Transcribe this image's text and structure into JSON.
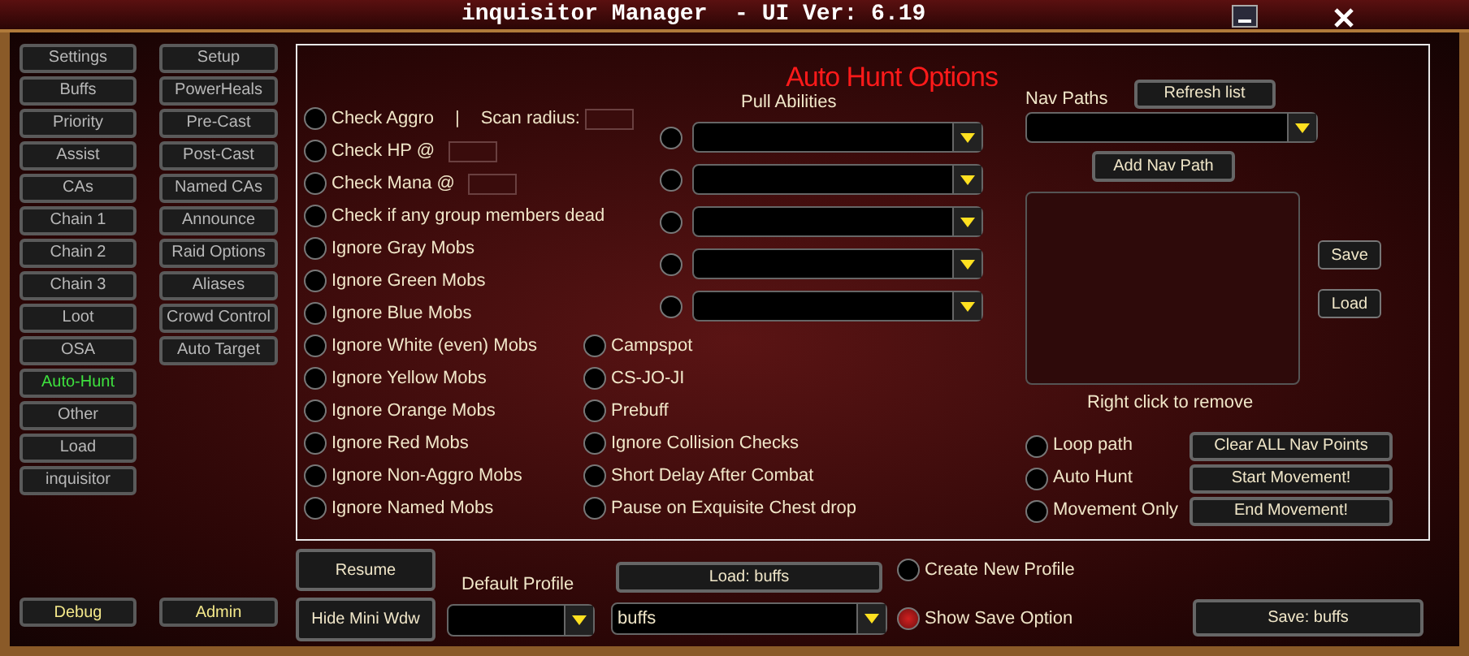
{
  "window": {
    "title": "inquisitor Manager  - UI Ver: 6.19"
  },
  "sidebar": {
    "left": [
      {
        "label": "Settings",
        "selected": false
      },
      {
        "label": "Buffs",
        "selected": false
      },
      {
        "label": "Priority",
        "selected": false
      },
      {
        "label": "Assist",
        "selected": false
      },
      {
        "label": "CAs",
        "selected": false
      },
      {
        "label": "Chain 1",
        "selected": false
      },
      {
        "label": "Chain 2",
        "selected": false
      },
      {
        "label": "Chain 3",
        "selected": false
      },
      {
        "label": "Loot",
        "selected": false
      },
      {
        "label": "OSA",
        "selected": false
      },
      {
        "label": "Auto-Hunt",
        "selected": true
      },
      {
        "label": "Other",
        "selected": false
      },
      {
        "label": "Load",
        "selected": false
      },
      {
        "label": "inquisitor",
        "selected": false
      }
    ],
    "right": [
      {
        "label": "Setup",
        "selected": false
      },
      {
        "label": "PowerHeals",
        "selected": false
      },
      {
        "label": "Pre-Cast",
        "selected": false
      },
      {
        "label": "Post-Cast",
        "selected": false
      },
      {
        "label": "Named CAs",
        "selected": false
      },
      {
        "label": "Announce",
        "selected": false
      },
      {
        "label": "Raid Options",
        "selected": false
      },
      {
        "label": "Aliases",
        "selected": false
      },
      {
        "label": "Crowd Control",
        "selected": false
      },
      {
        "label": "Auto Target",
        "selected": false
      }
    ],
    "footer_buttons": [
      "Debug",
      "Admin"
    ]
  },
  "panel": {
    "title": "Auto Hunt Options",
    "options": [
      {
        "kind": "scan",
        "label": "Check Aggro",
        "divider": "|",
        "field_label": "Scan radius:",
        "checked": false
      },
      {
        "kind": "field",
        "label": "Check HP @",
        "checked": false
      },
      {
        "kind": "field",
        "label": "Check Mana @",
        "checked": false
      },
      {
        "kind": "plain",
        "label": "Check if any group members dead",
        "checked": false
      },
      {
        "kind": "plain",
        "label": "Ignore Gray Mobs",
        "checked": false
      },
      {
        "kind": "plain",
        "label": "Ignore Green Mobs",
        "checked": false
      },
      {
        "kind": "plain",
        "label": "Ignore Blue Mobs",
        "checked": false
      },
      {
        "kind": "plain",
        "label": "Ignore White (even) Mobs",
        "checked": false
      },
      {
        "kind": "plain",
        "label": "Ignore Yellow Mobs",
        "checked": false
      },
      {
        "kind": "plain",
        "label": "Ignore Orange Mobs",
        "checked": false
      },
      {
        "kind": "plain",
        "label": "Ignore Red Mobs",
        "checked": false
      },
      {
        "kind": "plain",
        "label": "Ignore Non-Aggro Mobs",
        "checked": false
      },
      {
        "kind": "plain",
        "label": "Ignore Named Mobs",
        "checked": false
      }
    ],
    "options_right": [
      {
        "label": "Campspot",
        "checked": false
      },
      {
        "label": "CS-JO-JI",
        "checked": false
      },
      {
        "label": "Prebuff",
        "checked": false
      },
      {
        "label": "Ignore Collision Checks",
        "checked": false
      },
      {
        "label": "Short Delay After Combat",
        "checked": false
      },
      {
        "label": "Pause on Exquisite Chest drop",
        "checked": false
      }
    ],
    "pull_abilities": {
      "title": "Pull Abilities",
      "slots": [
        {
          "checked": false
        },
        {
          "checked": false
        },
        {
          "checked": false
        },
        {
          "checked": false
        },
        {
          "checked": false
        }
      ]
    },
    "nav": {
      "title": "Nav Paths",
      "refresh": "Refresh list",
      "add": "Add Nav Path",
      "save": "Save",
      "load": "Load",
      "hint": "Right click to remove",
      "options": [
        {
          "label": "Loop path",
          "checked": false
        },
        {
          "label": "Auto Hunt",
          "checked": false
        },
        {
          "label": "Movement Only",
          "checked": false
        }
      ],
      "buttons": [
        "Clear ALL Nav Points",
        "Start Movement!",
        "End Movement!"
      ]
    }
  },
  "bottom": {
    "resume": "Resume",
    "hide": "Hide Mini Wdw",
    "default_profile": "Default Profile",
    "load": "Load: buffs",
    "profile": "buffs",
    "options": [
      {
        "label": "Create New Profile",
        "checked": false
      },
      {
        "label": "Show Save Option",
        "checked": true
      }
    ],
    "save": "Save: buffs"
  }
}
